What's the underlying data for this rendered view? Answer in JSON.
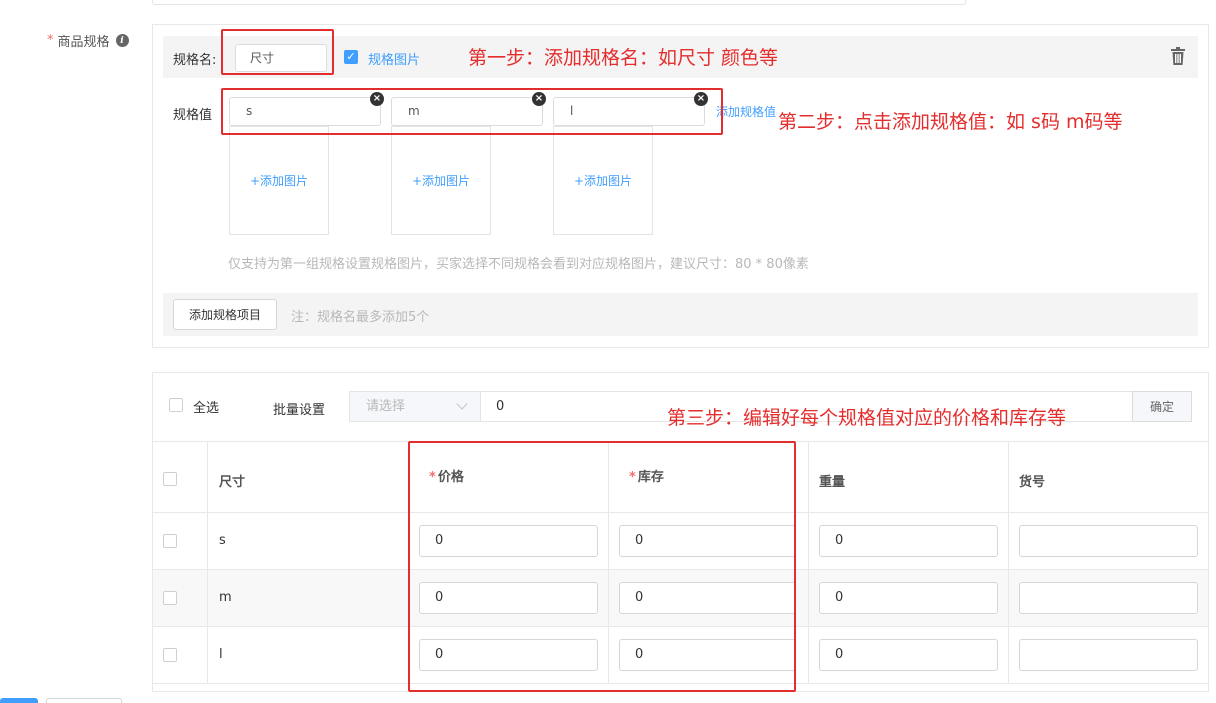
{
  "field": {
    "label": "商品规格",
    "required_mark": "*",
    "info_icon": "info-icon"
  },
  "spec": {
    "name_label": "规格名:",
    "name_value": "尺寸",
    "image_checkbox_label": "规格图片",
    "image_checkbox_checked": true,
    "value_label": "规格值",
    "values": [
      "s",
      "m",
      "l"
    ],
    "add_value_link": "添加规格值",
    "add_image_label": "+添加图片",
    "image_hint": "仅支持为第一组规格设置规格图片，买家选择不同规格会看到对应规格图片，建议尺寸：80 * 80像素",
    "add_item_button": "添加规格项目",
    "add_item_note": "注：规格名最多添加5个"
  },
  "table": {
    "select_all_label": "全选",
    "batch_label": "批量设置",
    "batch_select_placeholder": "请选择",
    "batch_value": "0",
    "confirm_button": "确定",
    "headers": {
      "size": "尺寸",
      "price": "价格",
      "stock": "库存",
      "weight": "重量",
      "sku": "货号"
    },
    "rows": [
      {
        "size": "s",
        "price": "0",
        "stock": "0",
        "weight": "0",
        "sku": ""
      },
      {
        "size": "m",
        "price": "0",
        "stock": "0",
        "weight": "0",
        "sku": ""
      },
      {
        "size": "l",
        "price": "0",
        "stock": "0",
        "weight": "0",
        "sku": ""
      }
    ]
  },
  "annotations": {
    "step1": "第一步：添加规格名：如尺寸 颜色等",
    "step2": "第二步：点击添加规格值：如 s码 m码等",
    "step3": "第三步：编辑好每个规格值对应的价格和库存等"
  },
  "colors": {
    "accent": "#409eff",
    "annotation_red": "#e42d2d",
    "required_red": "#f56c6c"
  }
}
